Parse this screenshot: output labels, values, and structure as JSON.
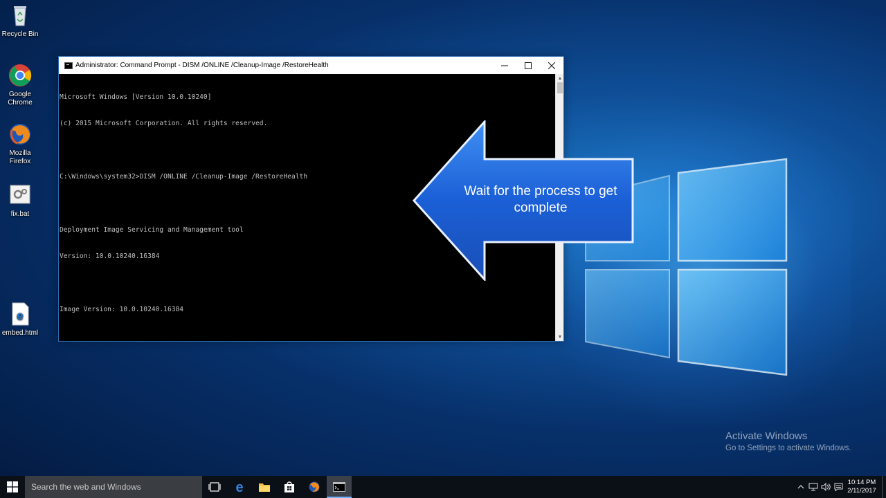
{
  "desktop": {
    "icons": [
      {
        "label": "Recycle Bin",
        "icon": "recycle-bin-icon"
      },
      {
        "label": "Google Chrome",
        "icon": "chrome-icon"
      },
      {
        "label": "Mozilla Firefox",
        "icon": "firefox-icon"
      },
      {
        "label": "fix.bat",
        "icon": "batch-file-icon"
      },
      {
        "label": "embed.html",
        "icon": "edge-html-file-icon"
      }
    ]
  },
  "cmd": {
    "title": "Administrator: Command Prompt - DISM  /ONLINE /Cleanup-Image /RestoreHealth",
    "lines": [
      "Microsoft Windows [Version 10.0.10240]",
      "(c) 2015 Microsoft Corporation. All rights reserved.",
      "",
      "C:\\Windows\\system32>DISM /ONLINE /Cleanup-Image /RestoreHealth",
      "",
      "Deployment Image Servicing and Management tool",
      "Version: 10.0.10240.16384",
      "",
      "Image Version: 10.0.10240.16384"
    ]
  },
  "callout": {
    "text": "Wait for the process to get complete",
    "color": "#1b5fd6"
  },
  "watermark": {
    "title": "Activate Windows",
    "subtitle": "Go to Settings to activate Windows."
  },
  "taskbar": {
    "search_placeholder": "Search the web and Windows",
    "pinned": [
      "task-view-icon",
      "edge-icon",
      "file-explorer-icon",
      "store-icon",
      "firefox-icon",
      "command-prompt-icon"
    ],
    "clock_time": "10:14 PM",
    "clock_date": "2/11/2017"
  },
  "colors": {
    "accent": "#6fb1ff",
    "taskbar": "#0b0f16"
  }
}
